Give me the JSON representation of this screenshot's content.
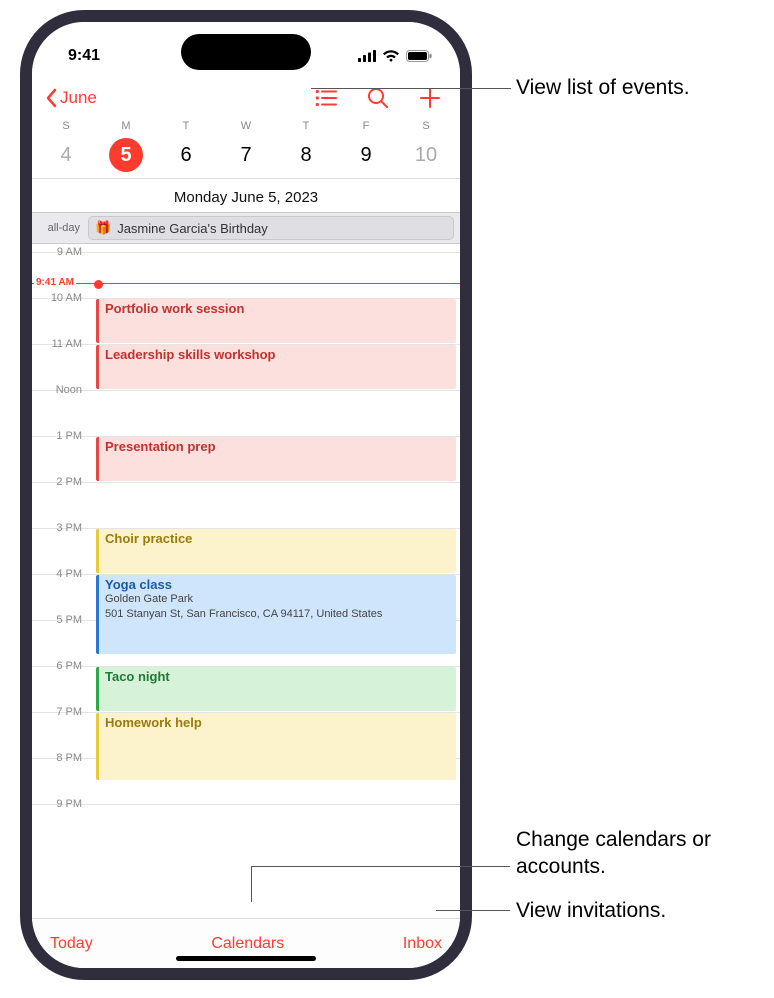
{
  "status": {
    "time": "9:41"
  },
  "nav": {
    "back_label": "June"
  },
  "week": {
    "headers": [
      "S",
      "M",
      "T",
      "W",
      "T",
      "F",
      "S"
    ],
    "days": [
      {
        "num": "4",
        "weekend": true,
        "selected": false
      },
      {
        "num": "5",
        "weekend": false,
        "selected": true
      },
      {
        "num": "6",
        "weekend": false,
        "selected": false
      },
      {
        "num": "7",
        "weekend": false,
        "selected": false
      },
      {
        "num": "8",
        "weekend": false,
        "selected": false
      },
      {
        "num": "9",
        "weekend": false,
        "selected": false
      },
      {
        "num": "10",
        "weekend": true,
        "selected": false
      }
    ],
    "date_heading": "Monday   June 5, 2023"
  },
  "allday": {
    "label": "all-day",
    "event": "Jasmine Garcia's Birthday"
  },
  "timeline": {
    "hours": [
      "9 AM",
      "10 AM",
      "11 AM",
      "Noon",
      "1 PM",
      "2 PM",
      "3 PM",
      "4 PM",
      "5 PM",
      "6 PM",
      "7 PM",
      "8 PM",
      "9 PM"
    ],
    "now_label": "9:41 AM",
    "events": [
      {
        "title": "Portfolio work session",
        "color": "red",
        "start": 10,
        "end": 11
      },
      {
        "title": "Leadership skills workshop",
        "color": "red",
        "start": 11,
        "end": 12
      },
      {
        "title": "Presentation prep",
        "color": "red",
        "start": 13,
        "end": 14
      },
      {
        "title": "Choir practice",
        "color": "yellow",
        "start": 15,
        "end": 16
      },
      {
        "title": "Yoga class",
        "sub1": "Golden Gate Park",
        "sub2": "501 Stanyan St, San Francisco, CA 94117, United States",
        "color": "blue",
        "start": 16,
        "end": 17.75
      },
      {
        "title": "Taco night",
        "color": "green",
        "start": 18,
        "end": 19
      },
      {
        "title": "Homework help",
        "color": "yellow",
        "start": 19,
        "end": 20.5
      }
    ]
  },
  "toolbar": {
    "today": "Today",
    "calendars": "Calendars",
    "inbox": "Inbox"
  },
  "callouts": {
    "list": "View list of events.",
    "calendars": "Change calendars or accounts.",
    "inbox": "View invitations."
  }
}
